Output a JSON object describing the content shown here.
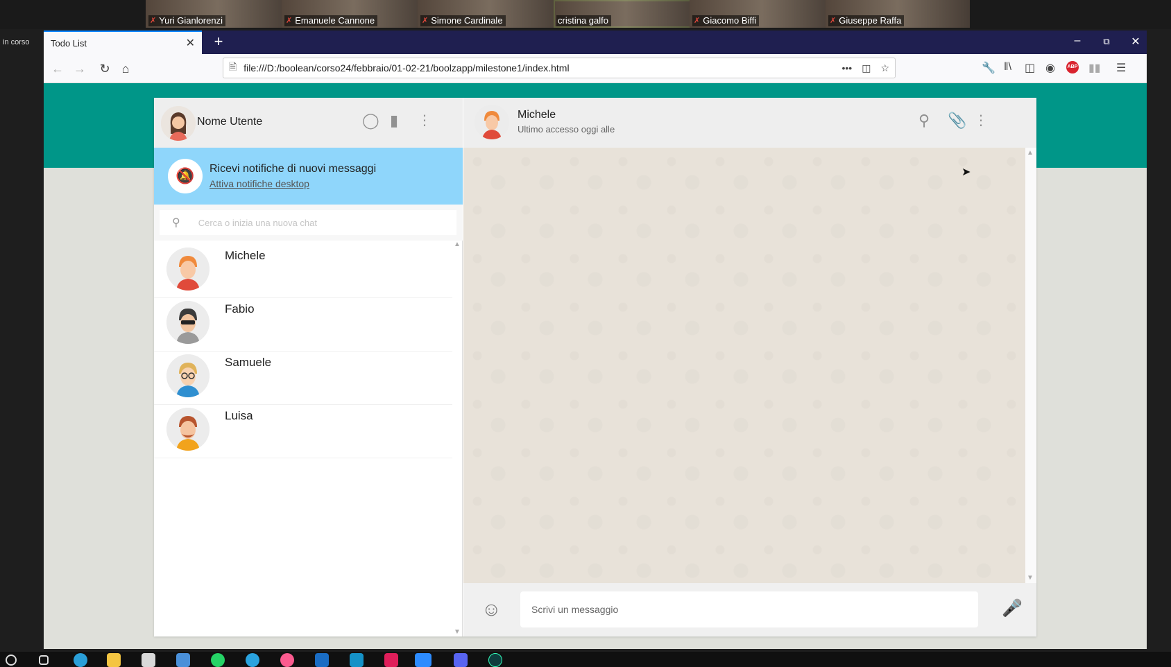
{
  "meeting": {
    "participants": [
      {
        "name": "Yuri Gianlorenzi",
        "muted": true,
        "active": false
      },
      {
        "name": "Emanuele Cannone",
        "muted": true,
        "active": false
      },
      {
        "name": "Simone Cardinale",
        "muted": true,
        "active": false
      },
      {
        "name": "cristina galfo",
        "muted": false,
        "active": true
      },
      {
        "name": "Giacomo Biffi",
        "muted": true,
        "active": false
      },
      {
        "name": "Giuseppe Raffa",
        "muted": true,
        "active": false
      }
    ],
    "status_label": "in corso"
  },
  "browser": {
    "tab_title": "Todo List",
    "url": "file:///D:/boolean/corso24/febbraio/01-02-21/boolzapp/milestone1/index.html"
  },
  "sidebar": {
    "user_name": "Nome Utente",
    "notification": {
      "title": "Ricevi notifiche di nuovi messaggi",
      "link": "Attiva notifiche desktop"
    },
    "search_placeholder": "Cerca o inizia una nuova chat",
    "contacts": [
      {
        "name": "Michele",
        "color": "#f08a3c"
      },
      {
        "name": "Fabio",
        "color": "#3b3b3b"
      },
      {
        "name": "Samuele",
        "color": "#e0b35a"
      },
      {
        "name": "Luisa",
        "color": "#b8552e"
      }
    ]
  },
  "chat": {
    "contact_name": "Michele",
    "status": "Ultimo accesso oggi alle",
    "input_placeholder": "Scrivi un messaggio"
  },
  "colors": {
    "teal": "#009688",
    "notif_bg": "#8fd6fb",
    "header_bg": "#eeeeee",
    "chat_bg": "#e8e2d9"
  }
}
